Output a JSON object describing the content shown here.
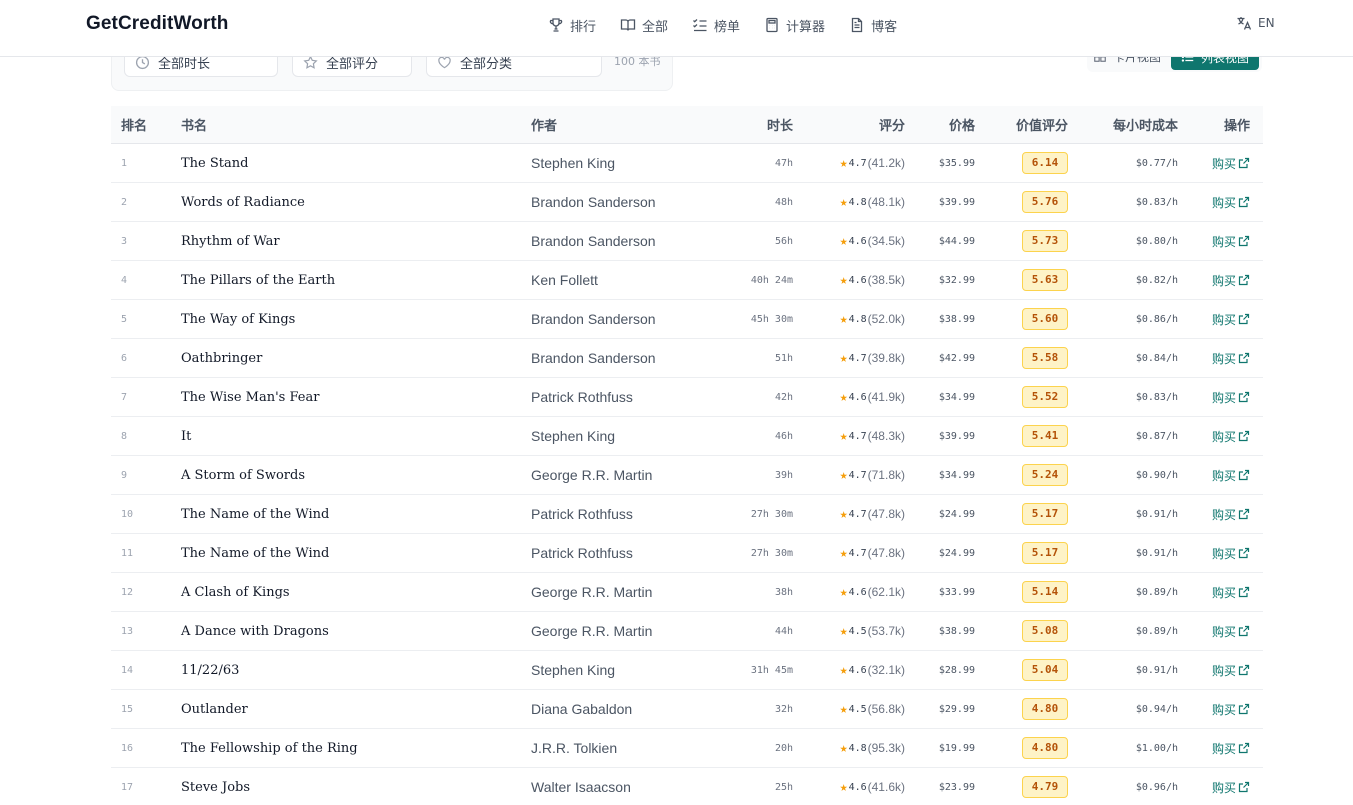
{
  "brand": "GetCreditWorth",
  "nav": [
    {
      "label": "排行",
      "icon": "trophy-icon"
    },
    {
      "label": "全部",
      "icon": "book-open-icon"
    },
    {
      "label": "榜单",
      "icon": "list-check-icon"
    },
    {
      "label": "计算器",
      "icon": "calculator-icon"
    },
    {
      "label": "博客",
      "icon": "document-icon"
    }
  ],
  "lang": {
    "label": "EN",
    "icon": "translate-icon"
  },
  "filters": {
    "duration": "全部时长",
    "rating": "全部评分",
    "category": "全部分类",
    "count": "100 本书"
  },
  "view": {
    "card": "卡片视图",
    "list": "列表视图"
  },
  "columns": {
    "rank": "排名",
    "title": "书名",
    "author": "作者",
    "duration": "时长",
    "rating": "评分",
    "price": "价格",
    "value": "价值评分",
    "cost_per_hour": "每小时成本",
    "action": "操作"
  },
  "buy_label": "购买",
  "books": [
    {
      "rank": "1",
      "title": "The Stand",
      "author": "Stephen King",
      "duration": "47h",
      "rating": "4.7",
      "reviews": "(41.2k)",
      "price": "$35.99",
      "value": "6.14",
      "cph": "$0.77/h"
    },
    {
      "rank": "2",
      "title": "Words of Radiance",
      "author": "Brandon Sanderson",
      "duration": "48h",
      "rating": "4.8",
      "reviews": "(48.1k)",
      "price": "$39.99",
      "value": "5.76",
      "cph": "$0.83/h"
    },
    {
      "rank": "3",
      "title": "Rhythm of War",
      "author": "Brandon Sanderson",
      "duration": "56h",
      "rating": "4.6",
      "reviews": "(34.5k)",
      "price": "$44.99",
      "value": "5.73",
      "cph": "$0.80/h"
    },
    {
      "rank": "4",
      "title": "The Pillars of the Earth",
      "author": "Ken Follett",
      "duration": "40h 24m",
      "rating": "4.6",
      "reviews": "(38.5k)",
      "price": "$32.99",
      "value": "5.63",
      "cph": "$0.82/h"
    },
    {
      "rank": "5",
      "title": "The Way of Kings",
      "author": "Brandon Sanderson",
      "duration": "45h 30m",
      "rating": "4.8",
      "reviews": "(52.0k)",
      "price": "$38.99",
      "value": "5.60",
      "cph": "$0.86/h"
    },
    {
      "rank": "6",
      "title": "Oathbringer",
      "author": "Brandon Sanderson",
      "duration": "51h",
      "rating": "4.7",
      "reviews": "(39.8k)",
      "price": "$42.99",
      "value": "5.58",
      "cph": "$0.84/h"
    },
    {
      "rank": "7",
      "title": "The Wise Man's Fear",
      "author": "Patrick Rothfuss",
      "duration": "42h",
      "rating": "4.6",
      "reviews": "(41.9k)",
      "price": "$34.99",
      "value": "5.52",
      "cph": "$0.83/h"
    },
    {
      "rank": "8",
      "title": "It",
      "author": "Stephen King",
      "duration": "46h",
      "rating": "4.7",
      "reviews": "(48.3k)",
      "price": "$39.99",
      "value": "5.41",
      "cph": "$0.87/h"
    },
    {
      "rank": "9",
      "title": "A Storm of Swords",
      "author": "George R.R. Martin",
      "duration": "39h",
      "rating": "4.7",
      "reviews": "(71.8k)",
      "price": "$34.99",
      "value": "5.24",
      "cph": "$0.90/h"
    },
    {
      "rank": "10",
      "title": "The Name of the Wind",
      "author": "Patrick Rothfuss",
      "duration": "27h 30m",
      "rating": "4.7",
      "reviews": "(47.8k)",
      "price": "$24.99",
      "value": "5.17",
      "cph": "$0.91/h"
    },
    {
      "rank": "11",
      "title": "The Name of the Wind",
      "author": "Patrick Rothfuss",
      "duration": "27h 30m",
      "rating": "4.7",
      "reviews": "(47.8k)",
      "price": "$24.99",
      "value": "5.17",
      "cph": "$0.91/h"
    },
    {
      "rank": "12",
      "title": "A Clash of Kings",
      "author": "George R.R. Martin",
      "duration": "38h",
      "rating": "4.6",
      "reviews": "(62.1k)",
      "price": "$33.99",
      "value": "5.14",
      "cph": "$0.89/h"
    },
    {
      "rank": "13",
      "title": "A Dance with Dragons",
      "author": "George R.R. Martin",
      "duration": "44h",
      "rating": "4.5",
      "reviews": "(53.7k)",
      "price": "$38.99",
      "value": "5.08",
      "cph": "$0.89/h"
    },
    {
      "rank": "14",
      "title": "11/22/63",
      "author": "Stephen King",
      "duration": "31h 45m",
      "rating": "4.6",
      "reviews": "(32.1k)",
      "price": "$28.99",
      "value": "5.04",
      "cph": "$0.91/h"
    },
    {
      "rank": "15",
      "title": "Outlander",
      "author": "Diana Gabaldon",
      "duration": "32h",
      "rating": "4.5",
      "reviews": "(56.8k)",
      "price": "$29.99",
      "value": "4.80",
      "cph": "$0.94/h"
    },
    {
      "rank": "16",
      "title": "The Fellowship of the Ring",
      "author": "J.R.R. Tolkien",
      "duration": "20h",
      "rating": "4.8",
      "reviews": "(95.3k)",
      "price": "$19.99",
      "value": "4.80",
      "cph": "$1.00/h"
    },
    {
      "rank": "17",
      "title": "Steve Jobs",
      "author": "Walter Isaacson",
      "duration": "25h",
      "rating": "4.6",
      "reviews": "(41.6k)",
      "price": "$23.99",
      "value": "4.79",
      "cph": "$0.96/h"
    }
  ]
}
